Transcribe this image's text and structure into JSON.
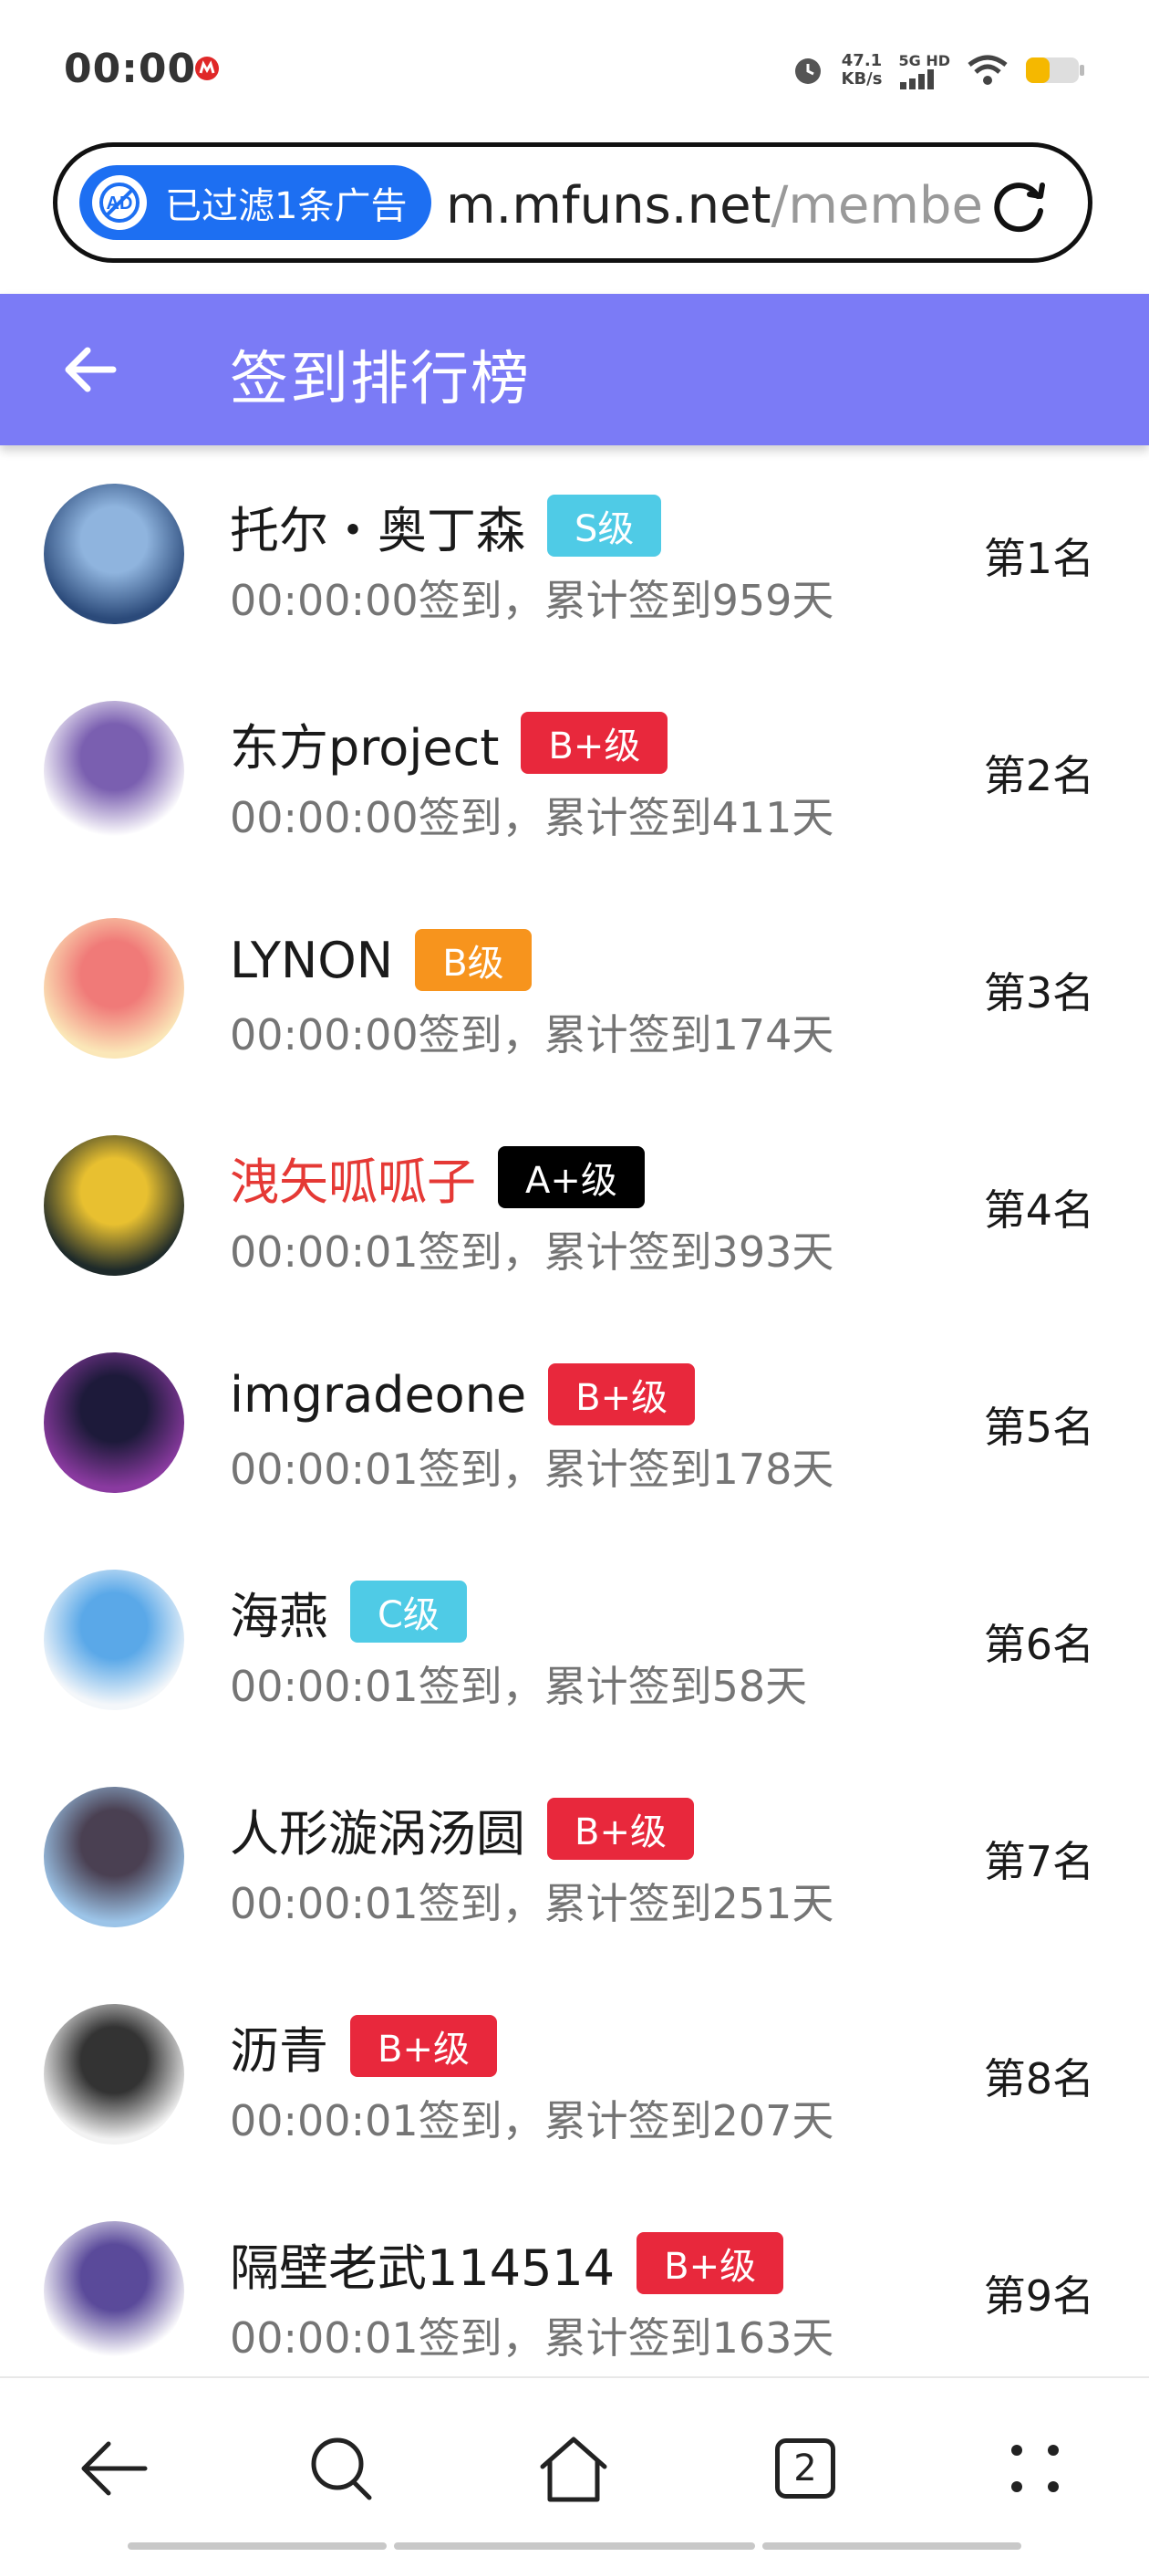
{
  "status_bar": {
    "time": "00:00",
    "net_speed_value": "47.1",
    "net_speed_unit": "KB/s",
    "network_type": "5G HD",
    "battery_color": "#f5b800"
  },
  "browser": {
    "ad_filter_label": "已过滤1条广告",
    "url_host": "m.mfuns.net",
    "url_path": "/membe"
  },
  "header": {
    "title": "签到排行榜",
    "bg_color": "#7b7bf6"
  },
  "ranking": [
    {
      "name": "托尔・奥丁森",
      "name_color": "default",
      "badge": "S级",
      "badge_color": "#4fcbe6",
      "detail": "00:00:00签到，累计签到959天",
      "rank": "第1名",
      "avatar_palette": [
        "#2b4a7a",
        "#8fb4de"
      ]
    },
    {
      "name": "东方project",
      "name_color": "default",
      "badge": "B+级",
      "badge_color": "#e8283c",
      "detail": "00:00:00签到，累计签到411天",
      "rank": "第2名",
      "avatar_palette": [
        "#ffffff",
        "#7a5fb0"
      ]
    },
    {
      "name": "LYNON",
      "name_color": "default",
      "badge": "B级",
      "badge_color": "#f7941d",
      "detail": "00:00:00签到，累计签到174天",
      "rank": "第3名",
      "avatar_palette": [
        "#fbe7b8",
        "#f07a78"
      ]
    },
    {
      "name": "洩矢呱呱子",
      "name_color": "red",
      "badge": "A+级",
      "badge_color": "#000000",
      "detail": "00:00:01签到，累计签到393天",
      "rank": "第4名",
      "avatar_palette": [
        "#1e2a2a",
        "#e8c030"
      ]
    },
    {
      "name": "imgradeone",
      "name_color": "default",
      "badge": "B+级",
      "badge_color": "#e8283c",
      "detail": "00:00:01签到，累计签到178天",
      "rank": "第5名",
      "avatar_palette": [
        "#8a3aa0",
        "#1d1a3a"
      ]
    },
    {
      "name": "海燕",
      "name_color": "default",
      "badge": "C级",
      "badge_color": "#4fcbe6",
      "detail": "00:00:01签到，累计签到58天",
      "rank": "第6名",
      "avatar_palette": [
        "#f4f7fa",
        "#5aa8e8"
      ]
    },
    {
      "name": "人形漩涡汤圆",
      "name_color": "default",
      "badge": "B+级",
      "badge_color": "#e8283c",
      "detail": "00:00:01签到，累计签到251天",
      "rank": "第7名",
      "avatar_palette": [
        "#9cc4e8",
        "#4a4052"
      ]
    },
    {
      "name": "沥青",
      "name_color": "default",
      "badge": "B+级",
      "badge_color": "#e8283c",
      "detail": "00:00:01签到，累计签到207天",
      "rank": "第8名",
      "avatar_palette": [
        "#f2f2f2",
        "#333333"
      ]
    },
    {
      "name": "隔壁老武114514",
      "name_color": "default",
      "badge": "B+级",
      "badge_color": "#e8283c",
      "detail": "00:00:01签到，累计签到163天",
      "rank": "第9名",
      "avatar_palette": [
        "#ffffff",
        "#5a4a9a"
      ]
    }
  ],
  "bottom_nav": {
    "items": [
      {
        "name": "back",
        "icon": "arrow-left-icon"
      },
      {
        "name": "search",
        "icon": "search-icon"
      },
      {
        "name": "home",
        "icon": "home-icon"
      },
      {
        "name": "tabs",
        "icon": "tabs-icon",
        "count": "2"
      },
      {
        "name": "menu",
        "icon": "more-dots-icon"
      }
    ]
  }
}
